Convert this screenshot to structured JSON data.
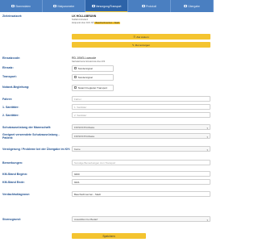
{
  "tabs": [
    {
      "label": "Stammdaten",
      "icon": "folder-icon"
    },
    {
      "label": "Vitalparameter",
      "icon": "heart-icon"
    },
    {
      "label": "Versorgung/Transport",
      "icon": "ambulance-icon"
    },
    {
      "label": "Protokoll",
      "icon": "document-icon"
    },
    {
      "label": "Übergabe",
      "icon": "handover-icon"
    }
  ],
  "destination": {
    "label": "Zieleinsatzort:",
    "name": "LK HOLLABRUNN",
    "line2": "Notfall Ambulanz",
    "line3": "Zeitpunkt über AVS NÖ",
    "tag": "Bauchschmerzen - Stadt",
    "btn_select": "Ziel ändern",
    "btn_map": "Ziel anzeigen"
  },
  "einsatzcode": {
    "label": "Einsatzcode:",
    "value": "RD-10M3-Lowcode",
    "hint": "Nachalarmierter Einsatzcode über AVS"
  },
  "einsatz": {
    "label": "Einsatz:",
    "option": "Sondersignal"
  },
  "transport": {
    "label": "Transport:",
    "option": "Sondersignal"
  },
  "notarzt": {
    "label": "Notarzt-Begleitung:",
    "option": "Notarzt begleitet Transport"
  },
  "fahrer": {
    "label": "Fahrer:",
    "placeholder": "Fahrer"
  },
  "sanitaeter1": {
    "label": "1. Sanitäter:",
    "placeholder": "1. Sanitäter"
  },
  "sanitaeter2": {
    "label": "2. Sanitäter:",
    "placeholder": "2. Sanitäter"
  },
  "schutz_mannschaft": {
    "label": "Schutzausrüstung der Mannschaft:",
    "value": "FFP2/FFP3-Maske"
  },
  "schutz_patient": {
    "label": "Geeignet verwendete Schutzausrüstung - Patient:",
    "value": "FFP2/FFP3-Maske"
  },
  "verzoegerung": {
    "label": "Verzögerung / Probleme bei der Übergabe im KH:",
    "value": "Keine"
  },
  "bemerkungen": {
    "label": "Bemerkungen:",
    "placeholder": "Sonstige Bemerkungen zum Transport"
  },
  "km_beginn": {
    "label": "KM-Stand Beginn:",
    "value": "9460"
  },
  "km_ende": {
    "label": "KM-Stand Ende:",
    "value": "9421"
  },
  "verdachtsdiagnose": {
    "label": "Verdachtsdiagnose:",
    "value": "Bauchschmerzen - Stadt"
  },
  "storno": {
    "label": "Stornogrund:",
    "value": "Auswählen bei Bedarf"
  },
  "save_label": "Speichern"
}
